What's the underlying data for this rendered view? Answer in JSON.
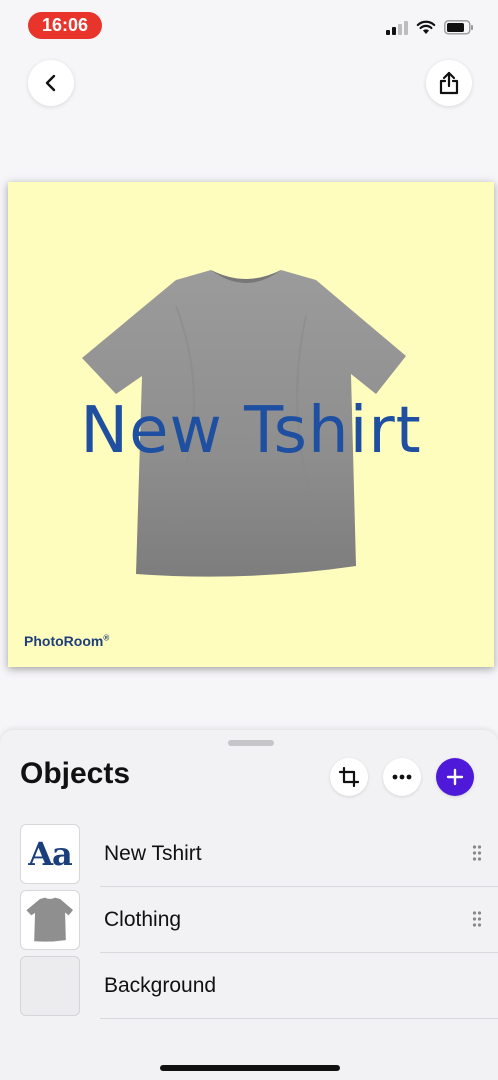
{
  "status_bar": {
    "time": "16:06",
    "icons": [
      "cellular-signal-icon",
      "wifi-icon",
      "battery-icon"
    ]
  },
  "nav": {
    "back_icon": "chevron-left-icon",
    "share_icon": "share-icon"
  },
  "canvas": {
    "background_color": "#fffdbd",
    "overlay_text": "New Tshirt",
    "overlay_text_color": "#1e4fa0",
    "watermark": "PhotoRoom",
    "watermark_mark": "®"
  },
  "objects_panel": {
    "title": "Objects",
    "actions": [
      "crop-icon",
      "more-icon",
      "plus-icon"
    ],
    "accent_color": "#4e19d8",
    "items": [
      {
        "label": "New Tshirt",
        "thumb": "Aa"
      },
      {
        "label": "Clothing"
      },
      {
        "label": "Background"
      }
    ]
  }
}
